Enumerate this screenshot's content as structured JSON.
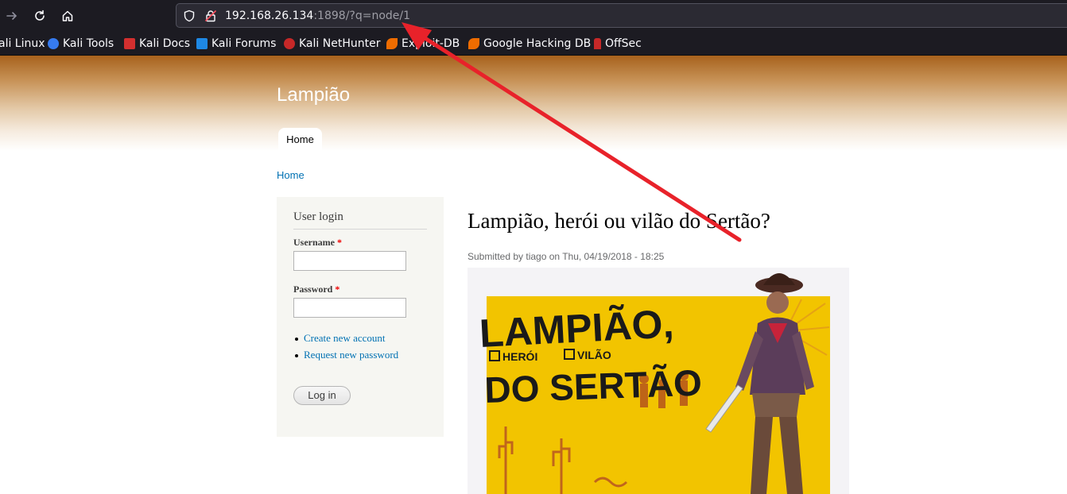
{
  "browser": {
    "url_host": "192.168.26.134",
    "url_rest": ":1898/?q=node/1",
    "bookmarks": [
      {
        "label": "ali Linux",
        "color": "#367bf0"
      },
      {
        "label": "Kali Tools",
        "color": "#e53935"
      },
      {
        "label": "Kali Docs",
        "color": "#d32f2f"
      },
      {
        "label": "Kali Forums",
        "color": "#1e88e5"
      },
      {
        "label": "Kali NetHunter",
        "color": "#c62828"
      },
      {
        "label": "Exploit-DB",
        "color": "#ef6c00"
      },
      {
        "label": "Google Hacking DB",
        "color": "#ef6c00"
      },
      {
        "label": "OffSec",
        "color": "#c62828"
      }
    ]
  },
  "site": {
    "name": "Lampião",
    "tabs": [
      "Home"
    ],
    "breadcrumb": "Home"
  },
  "login": {
    "title": "User login",
    "username_label": "Username",
    "password_label": "Password",
    "required_mark": "*",
    "links": [
      "Create new account",
      "Request new password"
    ],
    "button": "Log in"
  },
  "article": {
    "title": "Lampião, herói ou vilão do Sertão?",
    "submitted": "Submitted by tiago on Thu, 04/19/2018 - 18:25",
    "image": {
      "headline_1": "LAMPIÃO,",
      "checkbox_1": "HERÓI",
      "checkbox_2": "VILÃO",
      "headline_2": "DO SERTÃO"
    }
  },
  "colors": {
    "link": "#0071b3",
    "annotation_arrow": "#e8222a",
    "header_brown": "#a7621d",
    "poster_yellow": "#f2c400"
  }
}
